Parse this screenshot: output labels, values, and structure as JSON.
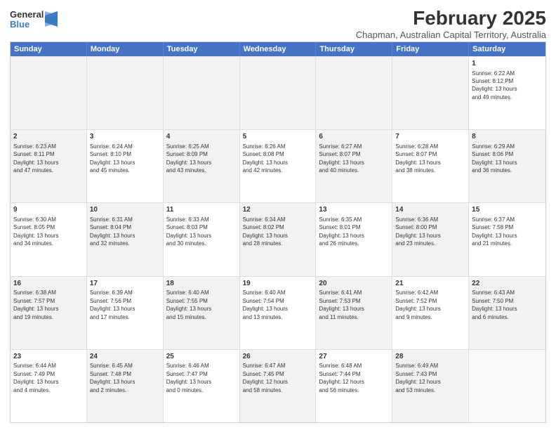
{
  "logo": {
    "general": "General",
    "blue": "Blue"
  },
  "title": "February 2025",
  "subtitle": "Chapman, Australian Capital Territory, Australia",
  "header_days": [
    "Sunday",
    "Monday",
    "Tuesday",
    "Wednesday",
    "Thursday",
    "Friday",
    "Saturday"
  ],
  "weeks": [
    [
      {
        "day": "",
        "text": "",
        "shaded": true
      },
      {
        "day": "",
        "text": "",
        "shaded": true
      },
      {
        "day": "",
        "text": "",
        "shaded": true
      },
      {
        "day": "",
        "text": "",
        "shaded": true
      },
      {
        "day": "",
        "text": "",
        "shaded": true
      },
      {
        "day": "",
        "text": "",
        "shaded": true
      },
      {
        "day": "1",
        "text": "Sunrise: 6:22 AM\nSunset: 8:12 PM\nDaylight: 13 hours\nand 49 minutes.",
        "shaded": false
      }
    ],
    [
      {
        "day": "2",
        "text": "Sunrise: 6:23 AM\nSunset: 8:11 PM\nDaylight: 13 hours\nand 47 minutes.",
        "shaded": true
      },
      {
        "day": "3",
        "text": "Sunrise: 6:24 AM\nSunset: 8:10 PM\nDaylight: 13 hours\nand 45 minutes.",
        "shaded": false
      },
      {
        "day": "4",
        "text": "Sunrise: 6:25 AM\nSunset: 8:09 PM\nDaylight: 13 hours\nand 43 minutes.",
        "shaded": true
      },
      {
        "day": "5",
        "text": "Sunrise: 6:26 AM\nSunset: 8:08 PM\nDaylight: 13 hours\nand 42 minutes.",
        "shaded": false
      },
      {
        "day": "6",
        "text": "Sunrise: 6:27 AM\nSunset: 8:07 PM\nDaylight: 13 hours\nand 40 minutes.",
        "shaded": true
      },
      {
        "day": "7",
        "text": "Sunrise: 6:28 AM\nSunset: 8:07 PM\nDaylight: 13 hours\nand 38 minutes.",
        "shaded": false
      },
      {
        "day": "8",
        "text": "Sunrise: 6:29 AM\nSunset: 8:06 PM\nDaylight: 13 hours\nand 36 minutes.",
        "shaded": true
      }
    ],
    [
      {
        "day": "9",
        "text": "Sunrise: 6:30 AM\nSunset: 8:05 PM\nDaylight: 13 hours\nand 34 minutes.",
        "shaded": false
      },
      {
        "day": "10",
        "text": "Sunrise: 6:31 AM\nSunset: 8:04 PM\nDaylight: 13 hours\nand 32 minutes.",
        "shaded": true
      },
      {
        "day": "11",
        "text": "Sunrise: 6:33 AM\nSunset: 8:03 PM\nDaylight: 13 hours\nand 30 minutes.",
        "shaded": false
      },
      {
        "day": "12",
        "text": "Sunrise: 6:34 AM\nSunset: 8:02 PM\nDaylight: 13 hours\nand 28 minutes.",
        "shaded": true
      },
      {
        "day": "13",
        "text": "Sunrise: 6:35 AM\nSunset: 8:01 PM\nDaylight: 13 hours\nand 26 minutes.",
        "shaded": false
      },
      {
        "day": "14",
        "text": "Sunrise: 6:36 AM\nSunset: 8:00 PM\nDaylight: 13 hours\nand 23 minutes.",
        "shaded": true
      },
      {
        "day": "15",
        "text": "Sunrise: 6:37 AM\nSunset: 7:58 PM\nDaylight: 13 hours\nand 21 minutes.",
        "shaded": false
      }
    ],
    [
      {
        "day": "16",
        "text": "Sunrise: 6:38 AM\nSunset: 7:57 PM\nDaylight: 13 hours\nand 19 minutes.",
        "shaded": true
      },
      {
        "day": "17",
        "text": "Sunrise: 6:39 AM\nSunset: 7:56 PM\nDaylight: 13 hours\nand 17 minutes.",
        "shaded": false
      },
      {
        "day": "18",
        "text": "Sunrise: 6:40 AM\nSunset: 7:55 PM\nDaylight: 13 hours\nand 15 minutes.",
        "shaded": true
      },
      {
        "day": "19",
        "text": "Sunrise: 6:40 AM\nSunset: 7:54 PM\nDaylight: 13 hours\nand 13 minutes.",
        "shaded": false
      },
      {
        "day": "20",
        "text": "Sunrise: 6:41 AM\nSunset: 7:53 PM\nDaylight: 13 hours\nand 11 minutes.",
        "shaded": true
      },
      {
        "day": "21",
        "text": "Sunrise: 6:42 AM\nSunset: 7:52 PM\nDaylight: 13 hours\nand 9 minutes.",
        "shaded": false
      },
      {
        "day": "22",
        "text": "Sunrise: 6:43 AM\nSunset: 7:50 PM\nDaylight: 13 hours\nand 6 minutes.",
        "shaded": true
      }
    ],
    [
      {
        "day": "23",
        "text": "Sunrise: 6:44 AM\nSunset: 7:49 PM\nDaylight: 13 hours\nand 4 minutes.",
        "shaded": false
      },
      {
        "day": "24",
        "text": "Sunrise: 6:45 AM\nSunset: 7:48 PM\nDaylight: 13 hours\nand 2 minutes.",
        "shaded": true
      },
      {
        "day": "25",
        "text": "Sunrise: 6:46 AM\nSunset: 7:47 PM\nDaylight: 13 hours\nand 0 minutes.",
        "shaded": false
      },
      {
        "day": "26",
        "text": "Sunrise: 6:47 AM\nSunset: 7:45 PM\nDaylight: 12 hours\nand 58 minutes.",
        "shaded": true
      },
      {
        "day": "27",
        "text": "Sunrise: 6:48 AM\nSunset: 7:44 PM\nDaylight: 12 hours\nand 56 minutes.",
        "shaded": false
      },
      {
        "day": "28",
        "text": "Sunrise: 6:49 AM\nSunset: 7:43 PM\nDaylight: 12 hours\nand 53 minutes.",
        "shaded": true
      },
      {
        "day": "",
        "text": "",
        "shaded": false
      }
    ]
  ]
}
